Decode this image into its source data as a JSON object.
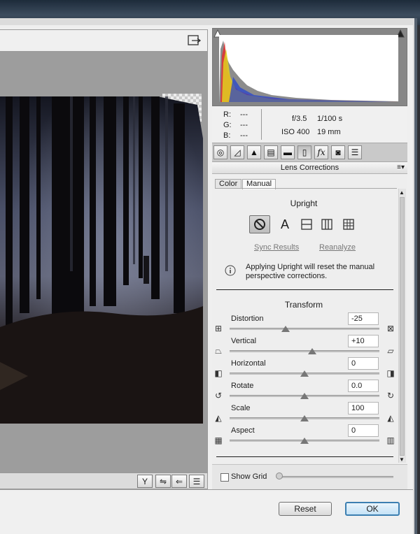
{
  "histogram": {
    "shadow_clip_icon": "triangle-icon",
    "highlight_clip_icon": "triangle-icon"
  },
  "info": {
    "r_label": "R:",
    "r_value": "---",
    "g_label": "G:",
    "g_value": "---",
    "b_label": "B:",
    "b_value": "---",
    "aperture": "f/3.5",
    "shutter": "1/100 s",
    "iso": "ISO 400",
    "focal": "19 mm"
  },
  "panel": {
    "title": "Lens Corrections",
    "tabs": [
      "Color",
      "Manual"
    ],
    "active_tab": "Manual",
    "upright_heading": "Upright",
    "upright_buttons": [
      "Off",
      "A"
    ],
    "sync_results": "Sync Results",
    "reanalyze": "Reanalyze",
    "note": "Applying Upright will reset the manual perspective corrections.",
    "transform_heading": "Transform",
    "sliders": [
      {
        "label": "Distortion",
        "value": "-25",
        "min": -100,
        "max": 100
      },
      {
        "label": "Vertical",
        "value": "+10",
        "min": -100,
        "max": 100
      },
      {
        "label": "Horizontal",
        "value": "0",
        "min": -100,
        "max": 100
      },
      {
        "label": "Rotate",
        "value": "0.0",
        "min": -10,
        "max": 10
      },
      {
        "label": "Scale",
        "value": "100",
        "min": 50,
        "max": 150
      },
      {
        "label": "Aspect",
        "value": "0",
        "min": -100,
        "max": 100
      }
    ],
    "show_grid_label": "Show Grid",
    "show_grid_checked": false
  },
  "footer": {
    "reset_label": "Reset",
    "ok_label": "OK"
  },
  "colors": {
    "accent_ok_border": "#3c7fb1",
    "panel_bg": "#eeeeee"
  }
}
